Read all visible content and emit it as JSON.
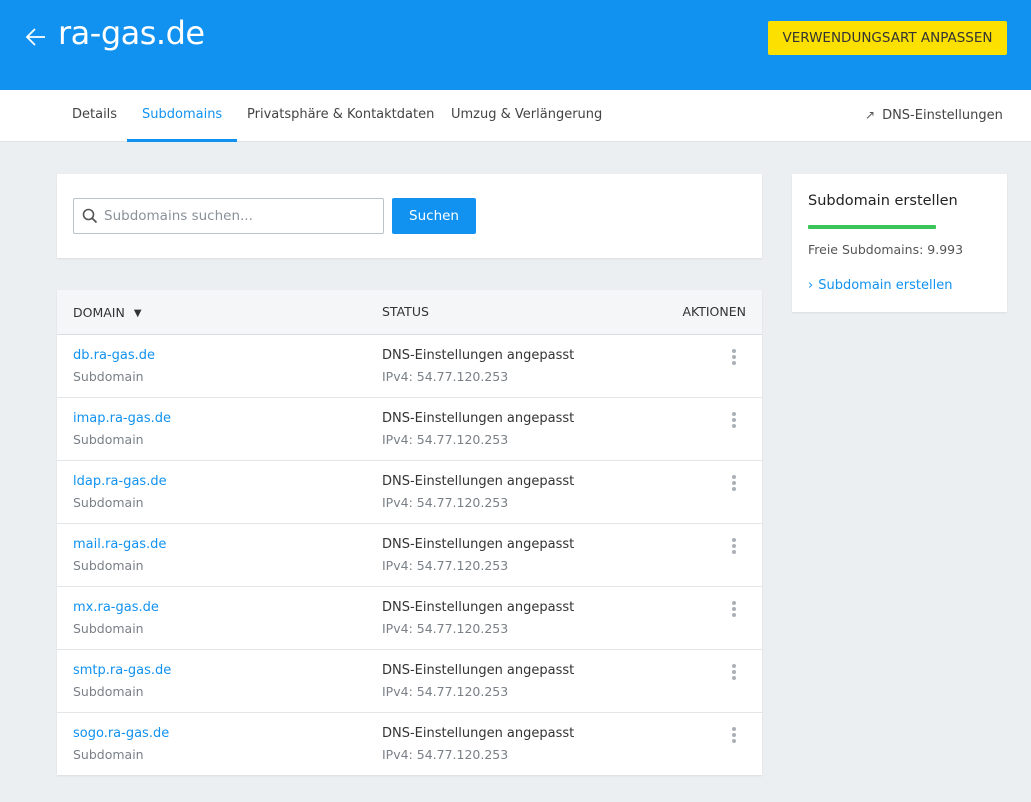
{
  "header": {
    "title": "ra-gas.de",
    "cta_label": "Verwendungsart anpassen",
    "back_icon": "arrow-left-icon",
    "accent_color": "#1192f0",
    "cta_color": "#fce000"
  },
  "tabs": [
    {
      "label": "Details",
      "active": false
    },
    {
      "label": "Subdomains",
      "active": true
    },
    {
      "label": "Privatsphäre & Kontaktdaten",
      "active": false
    },
    {
      "label": "Umzug & Verlängerung",
      "active": false
    }
  ],
  "dns_link": {
    "label": "DNS-Einstellungen",
    "icon": "external-arrow-icon"
  },
  "search": {
    "placeholder": "Subdomains suchen...",
    "value": "",
    "button_label": "Suchen",
    "icon": "search-icon"
  },
  "table": {
    "columns": {
      "domain": "Domain",
      "status": "Status",
      "actions": "Aktionen"
    },
    "sort_icon": "sort-down-icon",
    "rows": [
      {
        "domain": "db.ra-gas.de",
        "type": "Subdomain",
        "status": "DNS-Einstellungen angepasst",
        "ip": "IPv4: 54.77.120.253"
      },
      {
        "domain": "imap.ra-gas.de",
        "type": "Subdomain",
        "status": "DNS-Einstellungen angepasst",
        "ip": "IPv4: 54.77.120.253"
      },
      {
        "domain": "ldap.ra-gas.de",
        "type": "Subdomain",
        "status": "DNS-Einstellungen angepasst",
        "ip": "IPv4: 54.77.120.253"
      },
      {
        "domain": "mail.ra-gas.de",
        "type": "Subdomain",
        "status": "DNS-Einstellungen angepasst",
        "ip": "IPv4: 54.77.120.253"
      },
      {
        "domain": "mx.ra-gas.de",
        "type": "Subdomain",
        "status": "DNS-Einstellungen angepasst",
        "ip": "IPv4: 54.77.120.253"
      },
      {
        "domain": "smtp.ra-gas.de",
        "type": "Subdomain",
        "status": "DNS-Einstellungen angepasst",
        "ip": "IPv4: 54.77.120.253"
      },
      {
        "domain": "sogo.ra-gas.de",
        "type": "Subdomain",
        "status": "DNS-Einstellungen angepasst",
        "ip": "IPv4: 54.77.120.253"
      }
    ]
  },
  "sidebar": {
    "title": "Subdomain erstellen",
    "free_label": "Freie Subdomains: 9.993",
    "link_label": "Subdomain erstellen",
    "bar_color": "#3bc45a"
  }
}
